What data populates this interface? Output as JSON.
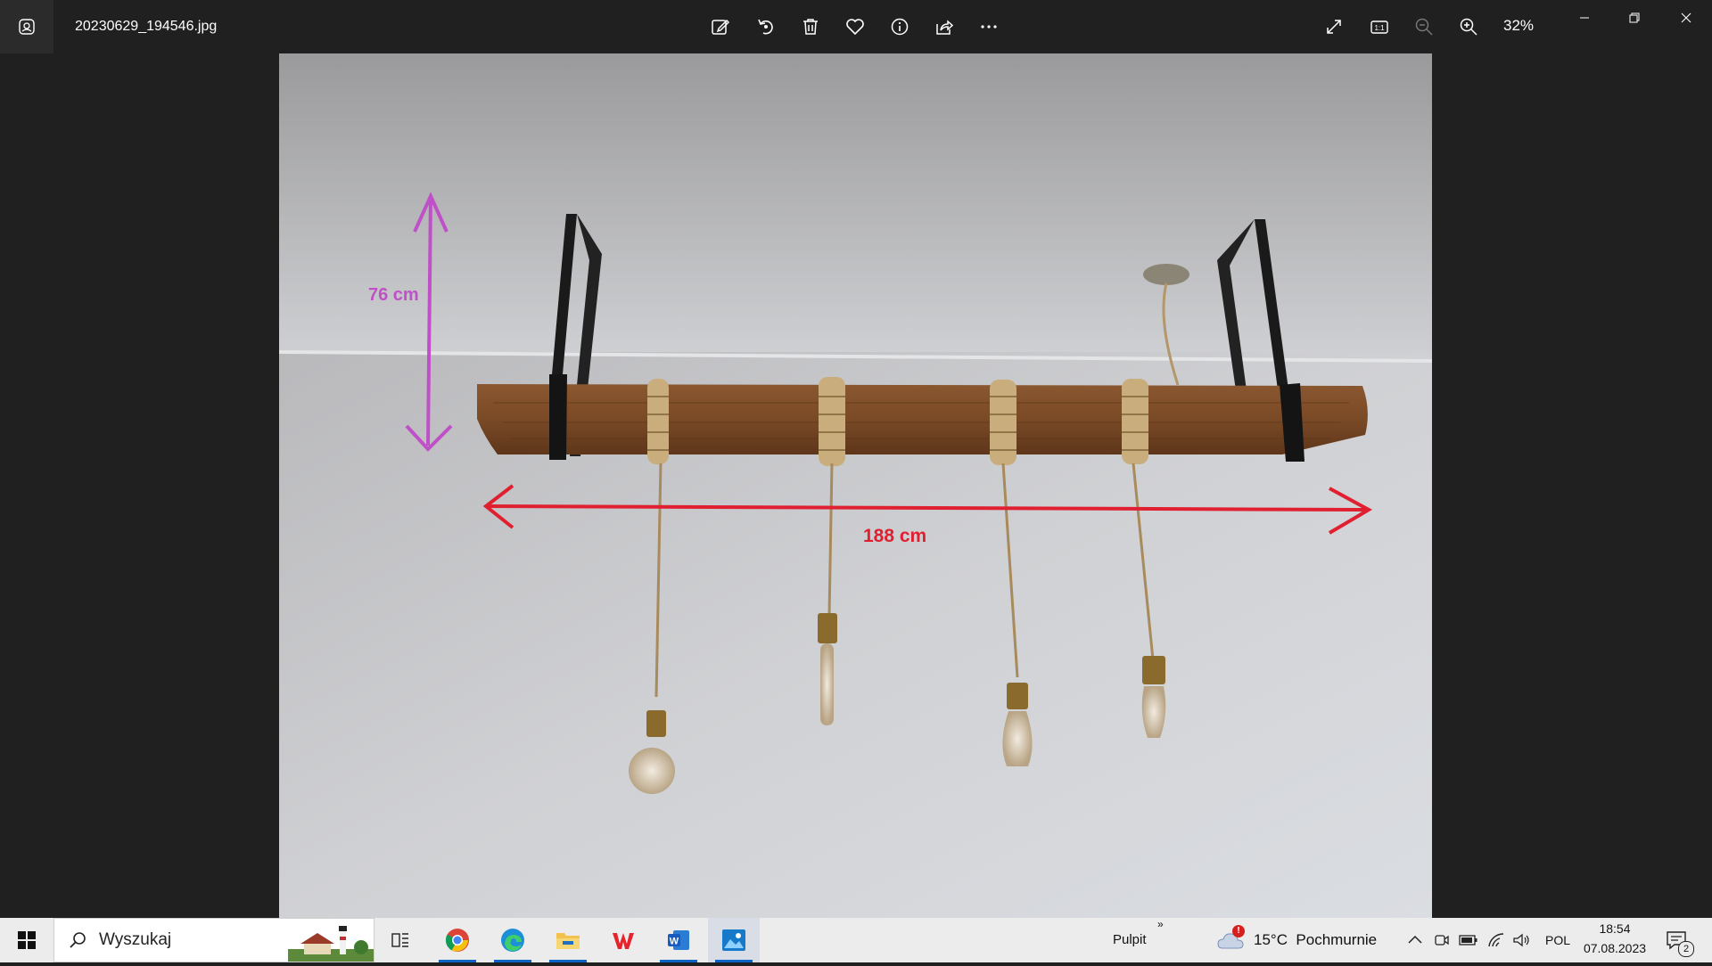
{
  "window": {
    "filename": "20230629_194546.jpg",
    "zoom": "32%"
  },
  "toolbar": {
    "icons": [
      "edit-icon",
      "rotate-icon",
      "delete-icon",
      "favorite-icon",
      "info-icon",
      "share-icon",
      "more-icon"
    ],
    "right_icons": [
      "fullscreen-icon",
      "actual-size-icon",
      "zoom-out-icon",
      "zoom-in-icon"
    ]
  },
  "photo": {
    "height_label": "76 cm",
    "width_label": "188 cm",
    "height_arrow_color": "#c050c8",
    "width_arrow_color": "#e02030"
  },
  "taskbar": {
    "search_placeholder": "Wyszukaj",
    "apps": [
      "task-view",
      "chrome",
      "edge",
      "file-explorer",
      "wps-office",
      "word",
      "photos"
    ],
    "desktop_label": "Pulpit",
    "weather": "15°C  Pochmurnie",
    "weather_badge": "!",
    "language": "POL",
    "time": "18:54",
    "date": "07.08.2023",
    "notification_count": "2"
  }
}
